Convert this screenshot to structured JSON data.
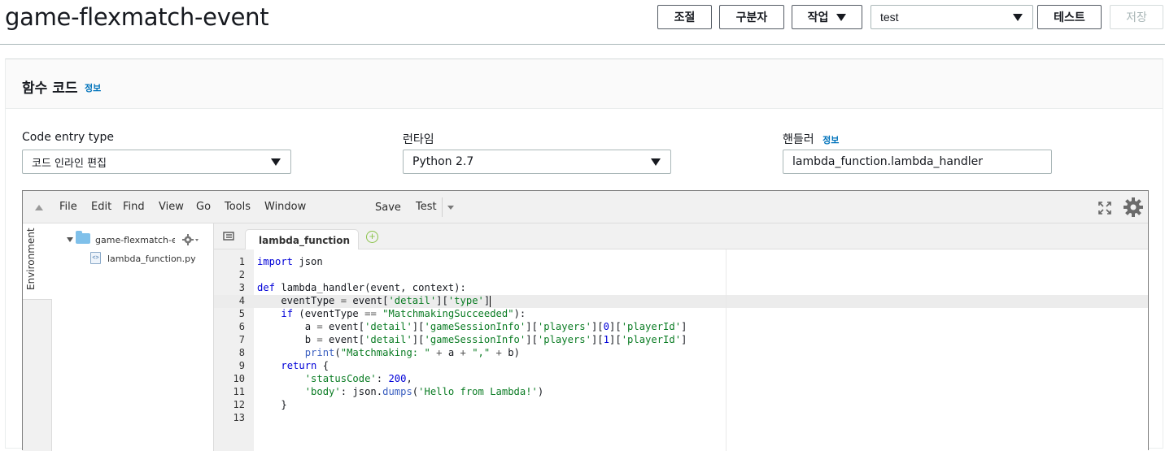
{
  "header": {
    "title": "game-flexmatch-event",
    "buttons": {
      "throttle": "조절",
      "qualifiers": "구분자",
      "actions": "작업",
      "test": "테스트",
      "save": "저장"
    },
    "test_event_select": "test"
  },
  "function_code": {
    "title": "함수 코드",
    "info": "정보",
    "code_entry_type": {
      "label": "Code entry type",
      "value": "코드 인라인 편집"
    },
    "runtime": {
      "label": "런타임",
      "value": "Python 2.7"
    },
    "handler": {
      "label": "핸들러",
      "info": "정보",
      "value": "lambda_function.lambda_handler"
    }
  },
  "ide": {
    "menu": [
      "File",
      "Edit",
      "Find",
      "View",
      "Go",
      "Tools",
      "Window"
    ],
    "save": "Save",
    "test": "Test",
    "environment_label": "Environment",
    "tree": {
      "folder": "game-flexmatch-eve",
      "file": "lambda_function.py"
    },
    "tab": "lambda_function",
    "line_numbers": [
      "1",
      "2",
      "3",
      "4",
      "5",
      "6",
      "7",
      "8",
      "9",
      "10",
      "11",
      "12",
      "13"
    ]
  },
  "icons": {
    "collapse": "triangle-up-icon",
    "fullscreen": "fullscreen-icon",
    "settings": "gear-icon",
    "add_tab": "plus-circle-icon"
  },
  "colors": {
    "keyword": "#0000d8",
    "string": "#0b7c24",
    "link": "#0073bb"
  }
}
